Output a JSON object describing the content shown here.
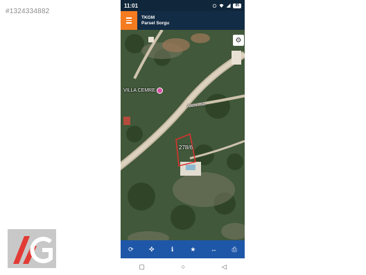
{
  "listing_id": "#1324334882",
  "status_bar": {
    "time": "11:01",
    "battery": "85"
  },
  "app": {
    "title": "TKGM",
    "subtitle": "Parsel Sorgu"
  },
  "map": {
    "poi_label": "VILLA CEMRE",
    "street_label": "Aremit Sk.",
    "parcel_label": "278/6"
  },
  "toolbar": {
    "items": [
      "refresh-icon",
      "locate-icon",
      "info-icon",
      "star-icon",
      "measure-icon",
      "print-icon"
    ]
  },
  "navbar": {
    "items": [
      "recents-icon",
      "home-icon",
      "back-icon"
    ]
  },
  "colors": {
    "header": "#132c45",
    "menu": "#f47b20",
    "toolbar": "#1f57a8",
    "parcel_outline": "#e0312f"
  }
}
